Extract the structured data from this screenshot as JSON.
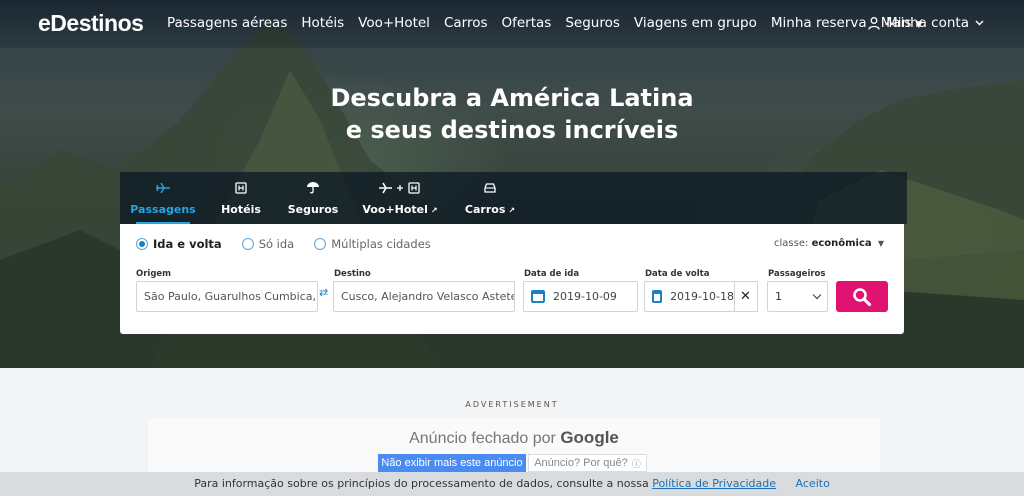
{
  "brand": {
    "logo_text": "eDestinos",
    "accent": "#1e9bd7",
    "cta_color": "#e0116f"
  },
  "nav": {
    "links": [
      "Passagens aéreas",
      "Hotéis",
      "Voo+Hotel",
      "Carros",
      "Ofertas",
      "Seguros",
      "Viagens em grupo",
      "Minha reserva",
      "Mais"
    ],
    "account": "Minha conta"
  },
  "hero": {
    "line1": "Descubra a América Latina",
    "line2": "e seus destinos incríveis"
  },
  "tabs": [
    {
      "label": "Passagens",
      "icon": "plane-icon",
      "active": true
    },
    {
      "label": "Hotéis",
      "icon": "hotel-icon",
      "active": false
    },
    {
      "label": "Seguros",
      "icon": "umbrella-icon",
      "active": false
    },
    {
      "label": "Voo+Hotel",
      "icon": "plane-plus-hotel-icon",
      "active": false
    },
    {
      "label": "Carros",
      "icon": "car-icon",
      "active": false
    }
  ],
  "search": {
    "trip_types": [
      "Ida e volta",
      "Só ida",
      "Múltiplas cidades"
    ],
    "selected_trip_type": "Ida e volta",
    "class_label": "classe:",
    "class_value": "econômica",
    "origin_label": "Origem",
    "origin_value": "São Paulo, Guarulhos Cumbica, São Paulo, Brasil",
    "destination_label": "Destino",
    "destination_value": "Cusco, Alejandro Velasco Astete, Cusco, Peru",
    "depart_label": "Data de ida",
    "depart_value": "2019-10-09",
    "return_label": "Data de volta",
    "return_value": "2019-10-18",
    "passengers_label": "Passageiros",
    "passengers_value": "1"
  },
  "ad": {
    "label": "ADVERTISEMENT",
    "closed_text": "Anúncio fechado por",
    "closed_brand": "Google",
    "stop_button": "Não exibir mais este anúncio",
    "why_button": "Anúncio? Por quê?"
  },
  "cookie": {
    "text": "Para informação sobre os princípios do processamento de dados, consulte a nossa",
    "link": "Política de Privacidade",
    "accept": "Aceito"
  }
}
